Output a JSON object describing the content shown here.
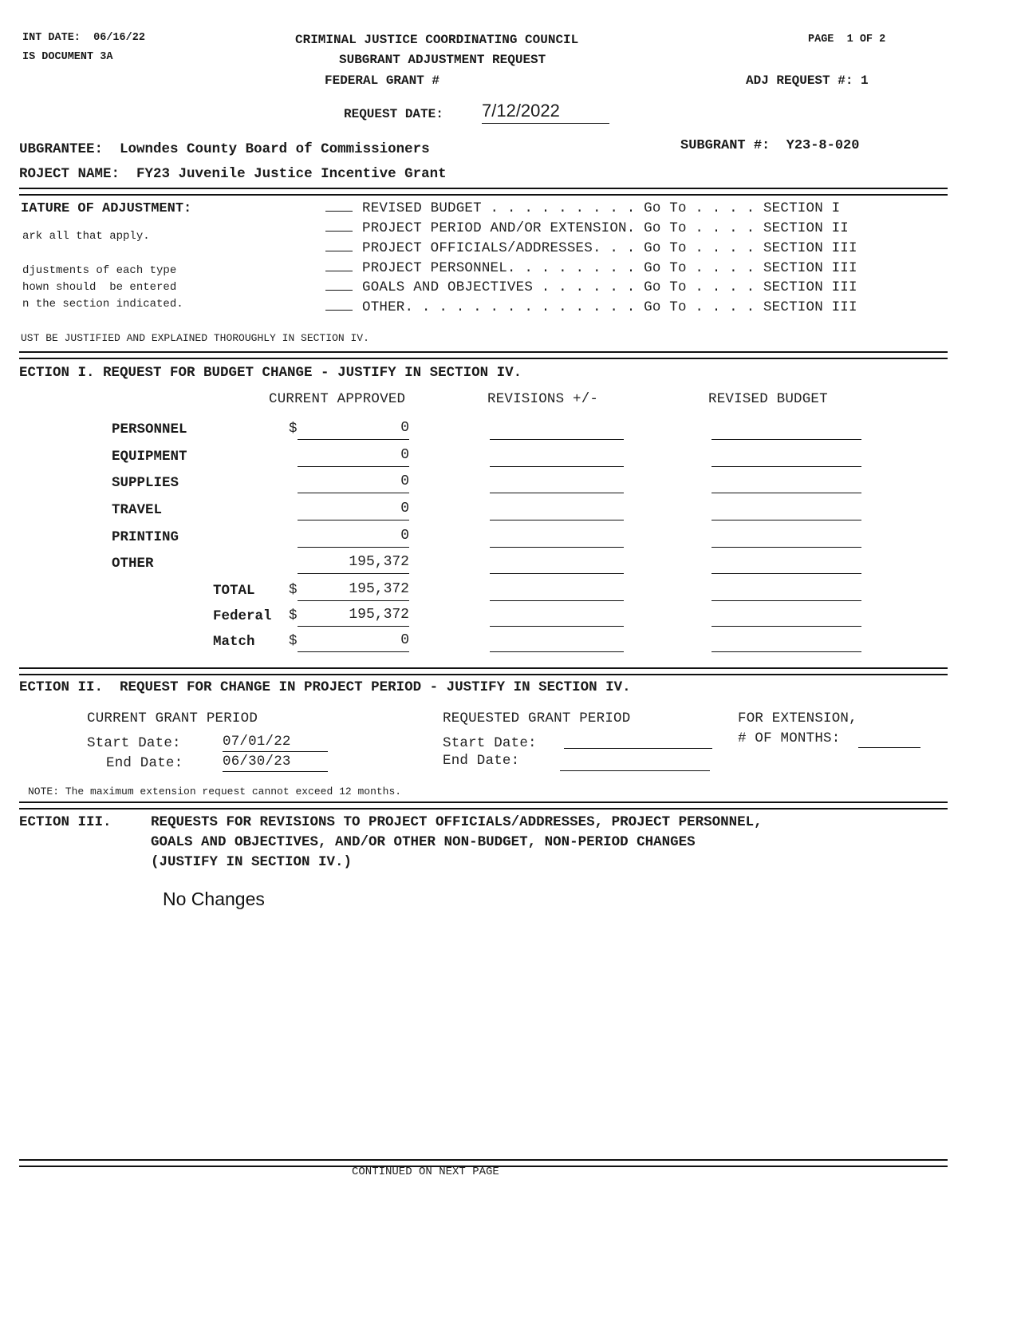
{
  "header": {
    "print_date_label": "INT DATE:",
    "print_date_value": "06/16/22",
    "doc_id": "IS DOCUMENT 3A",
    "agency": "CRIMINAL JUSTICE COORDINATING COUNCIL",
    "form_title": "SUBGRANT ADJUSTMENT REQUEST",
    "federal_grant_label": "FEDERAL GRANT #",
    "federal_grant_value": "",
    "page_label": "PAGE",
    "page_current": "1",
    "page_of": "OF 2",
    "adj_request_label": "ADJ REQUEST #:",
    "adj_request_value": "1",
    "request_date_label": "REQUEST DATE:",
    "request_date_value": "7/12/2022"
  },
  "subgrantee": {
    "label": "UBGRANTEE:",
    "value": "Lowndes County Board of Commissioners",
    "subgrant_label": "SUBGRANT #:",
    "subgrant_value": "Y23-8-020",
    "project_label": "ROJECT NAME:",
    "project_value": "FY23 Juvenile Justice Incentive Grant"
  },
  "nature": {
    "title": "IATURE OF ADJUSTMENT:",
    "note1": "ark all that apply.",
    "note2": "djustments of each type",
    "note3": "hown should  be entered",
    "note4": "n the section indicated.",
    "options": [
      {
        "label": "REVISED BUDGET . . . . . . . . . Go To . . . . SECTION I",
        "checked": false
      },
      {
        "label": "PROJECT PERIOD AND/OR EXTENSION. Go To . . . . SECTION II",
        "checked": false
      },
      {
        "label": "PROJECT OFFICIALS/ADDRESSES. . . Go To . . . . SECTION III",
        "checked": false
      },
      {
        "label": "PROJECT PERSONNEL. . . . . . . . Go To . . . . SECTION III",
        "checked": false
      },
      {
        "label": "GOALS AND OBJECTIVES . . . . . . Go To . . . . SECTION III",
        "checked": false
      },
      {
        "label": "OTHER. . . . . . . . . . . . . . Go To . . . . SECTION III",
        "checked": false
      }
    ],
    "footer": "UST BE JUSTIFIED AND EXPLAINED THOROUGHLY IN SECTION IV."
  },
  "section1": {
    "title": "ECTION I. REQUEST FOR BUDGET CHANGE - JUSTIFY IN SECTION IV.",
    "col_current": "CURRENT APPROVED",
    "col_revisions": "REVISIONS +/-",
    "col_revised": "REVISED BUDGET",
    "currency": "$",
    "rows": [
      {
        "label": "PERSONNEL",
        "current": "0",
        "revision": "",
        "revised": "",
        "dollar": true
      },
      {
        "label": "EQUIPMENT",
        "current": "0",
        "revision": "",
        "revised": "",
        "dollar": false
      },
      {
        "label": "SUPPLIES",
        "current": "0",
        "revision": "",
        "revised": "",
        "dollar": false
      },
      {
        "label": "TRAVEL",
        "current": "0",
        "revision": "",
        "revised": "",
        "dollar": false
      },
      {
        "label": "PRINTING",
        "current": "0",
        "revision": "",
        "revised": "",
        "dollar": false
      },
      {
        "label": "OTHER",
        "current": "195,372",
        "revision": "",
        "revised": "",
        "dollar": false
      }
    ],
    "totals": [
      {
        "label": "TOTAL",
        "current": "195,372",
        "revision": "",
        "revised": ""
      },
      {
        "label": "Federal",
        "current": "195,372",
        "revision": "",
        "revised": ""
      },
      {
        "label": "Match",
        "current": "0",
        "revision": "",
        "revised": ""
      }
    ]
  },
  "section2": {
    "title": "ECTION II.  REQUEST FOR CHANGE IN PROJECT PERIOD - JUSTIFY IN SECTION IV.",
    "current_label": "CURRENT GRANT PERIOD",
    "requested_label": "REQUESTED GRANT PERIOD",
    "extension_label1": "FOR EXTENSION,",
    "extension_label2": "# OF MONTHS:",
    "start_label": "Start Date:",
    "end_label": "End Date:",
    "current_start": "07/01/22",
    "current_end": "06/30/23",
    "requested_start": "",
    "requested_end": "",
    "extension_months": "",
    "note": "NOTE: The maximum extension request cannot exceed 12 months."
  },
  "section3": {
    "title": "ECTION III.",
    "line1": "REQUESTS FOR REVISIONS TO PROJECT OFFICIALS/ADDRESSES, PROJECT PERSONNEL,",
    "line2": "GOALS AND OBJECTIVES, AND/OR OTHER NON-BUDGET, NON-PERIOD CHANGES",
    "line3": "(JUSTIFY IN SECTION IV.)",
    "content": "No Changes"
  },
  "footer": {
    "continued": "CONTINUED ON NEXT PAGE"
  }
}
